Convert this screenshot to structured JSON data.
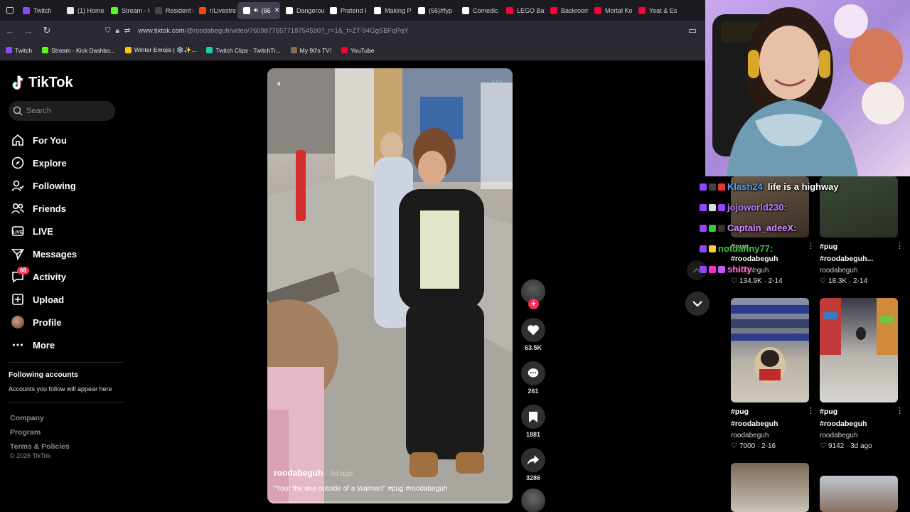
{
  "browser": {
    "tabs": [
      {
        "label": "Twitch",
        "fav": "#9146ff",
        "active": false
      },
      {
        "label": "(1) Home",
        "fav": "#e7e7e7",
        "active": false
      },
      {
        "label": "Stream - I",
        "fav": "#53fc18",
        "active": false
      },
      {
        "label": "Resident Evil",
        "fav": "#444",
        "active": false
      },
      {
        "label": "r/Livestre",
        "fav": "#ff4500",
        "active": false
      },
      {
        "label": "(66",
        "fav": "#ffffff",
        "active": true
      },
      {
        "label": "Dangerou",
        "fav": "#ffffff",
        "active": false
      },
      {
        "label": "Pretend I",
        "fav": "#ffffff",
        "active": false
      },
      {
        "label": "Making P",
        "fav": "#ffffff",
        "active": false
      },
      {
        "label": "(66)#fyp",
        "fav": "#ffffff",
        "active": false
      },
      {
        "label": "Comedic",
        "fav": "#ffffff",
        "active": false
      },
      {
        "label": "LEGO Bat",
        "fav": "#ff0033",
        "active": false
      },
      {
        "label": "Backroom",
        "fav": "#ff0033",
        "active": false
      },
      {
        "label": "Mortal Ko",
        "fav": "#ff0033",
        "active": false
      },
      {
        "label": "Yeat & Es",
        "fav": "#ff0033",
        "active": false
      }
    ],
    "url_host": "www.tiktok.com",
    "url_path": "/@roodabeguh/video/7609877657718754590?_r=1&_t=ZT-94GgSBFqPqY",
    "bookmarks": [
      {
        "label": "Twitch",
        "fav": "#9146ff"
      },
      {
        "label": "Stream - Kick Dashbo...",
        "fav": "#53fc18"
      },
      {
        "label": "Winter Emojis | ❄️✨...",
        "fav": "#f5c518"
      },
      {
        "label": "Twitch Clips · TwitchTr...",
        "fav": "#1fd1a4"
      },
      {
        "label": "My 90's TV!",
        "fav": "#8b6b4a"
      },
      {
        "label": "YouTube",
        "fav": "#ff0033"
      }
    ]
  },
  "tiktok": {
    "logo": "TikTok",
    "search_placeholder": "Search",
    "nav": [
      {
        "label": "For You",
        "icon": "home-icon"
      },
      {
        "label": "Explore",
        "icon": "compass-icon"
      },
      {
        "label": "Following",
        "icon": "following-icon"
      },
      {
        "label": "Friends",
        "icon": "friends-icon"
      },
      {
        "label": "LIVE",
        "icon": "live-icon"
      },
      {
        "label": "Messages",
        "icon": "messages-icon"
      },
      {
        "label": "Activity",
        "icon": "activity-icon",
        "badge": "66"
      },
      {
        "label": "Upload",
        "icon": "upload-icon"
      },
      {
        "label": "Profile",
        "icon": "avatar"
      },
      {
        "label": "More",
        "icon": "more-icon"
      }
    ],
    "following_title": "Following accounts",
    "following_sub": "Accounts you follow will appear here",
    "footer": [
      "Company",
      "Program",
      "Terms & Policies"
    ],
    "copyright": "© 2026 TikTok",
    "video": {
      "author": "roodabeguh",
      "ago": "· 4d ago",
      "caption": "\"Your the one outside of a Walmart\" #pug #roodabeguh"
    },
    "actions": {
      "likes": "63.5K",
      "comments": "261",
      "saves": "1881",
      "shares": "3286"
    },
    "related": [
      {
        "title": "#pug",
        "title2": "#roodabeguh",
        "author": "roodabeguh",
        "stats": "134.9K · 2-14"
      },
      {
        "title": "#pug",
        "title2": "#roodabeguh...",
        "author": "roodabeguh",
        "stats": "18.3K · 2-14"
      },
      {
        "title": "#pug",
        "title2": "#roodabeguh",
        "author": "roodabeguh",
        "stats": "7000 · 2-16"
      },
      {
        "title": "#pug",
        "title2": "#roodabeguh",
        "author": "roodabeguh",
        "stats": "9142 · 3d ago"
      }
    ]
  },
  "chat": [
    {
      "name": "Klash24",
      "message": "life is a highway",
      "color": "#4fa3ff"
    },
    {
      "name": "jojoworld230:",
      "message": "",
      "color": "#c07cff"
    },
    {
      "name": "Captain_adeeX:",
      "message": "",
      "color": "#d58cff"
    },
    {
      "name": "notdanny77:",
      "message": "",
      "color": "#3cc43c"
    },
    {
      "name": "shitty:",
      "message": "",
      "color": "#ff66cc"
    }
  ]
}
